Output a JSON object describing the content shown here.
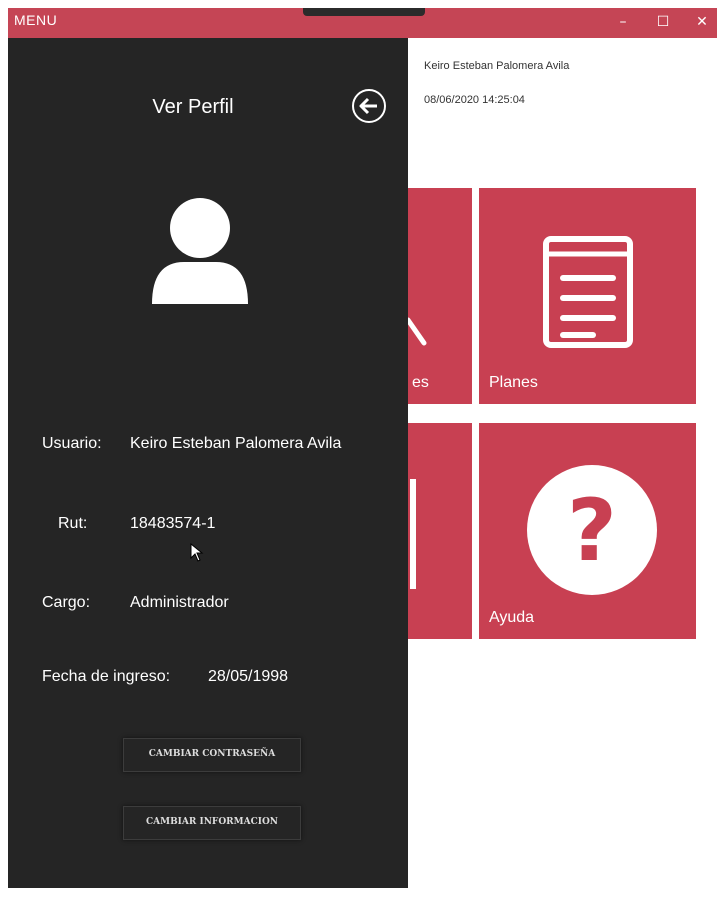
{
  "window": {
    "title": "MENU",
    "minimize": "–",
    "maximize": "☐",
    "close": "✕"
  },
  "header": {
    "user_name": "Keiro Esteban Palomera Avila",
    "datetime": "08/06/2020 14:25:04"
  },
  "tiles": [
    {
      "label": "es",
      "icon": "tool-icon"
    },
    {
      "label": "Planes",
      "icon": "document-list-icon"
    },
    {
      "label": "",
      "icon": ""
    },
    {
      "label": "Ayuda",
      "icon": "help-question-icon"
    }
  ],
  "drawer": {
    "title": "Ver Perfil",
    "fields": [
      {
        "label": "Usuario:",
        "value": "Keiro Esteban Palomera Avila"
      },
      {
        "label": "Rut:",
        "value": "18483574-1"
      },
      {
        "label": "Cargo:",
        "value": "Administrador"
      },
      {
        "label": "Fecha de ingreso:",
        "value": "28/05/1998"
      }
    ],
    "buttons": {
      "change_password": "CAMBIAR CONTRASEÑA",
      "change_info": "CAMBIAR INFORMACION"
    }
  },
  "colors": {
    "accent": "#c84052",
    "titlebar": "#c54555",
    "drawer": "#252525"
  }
}
